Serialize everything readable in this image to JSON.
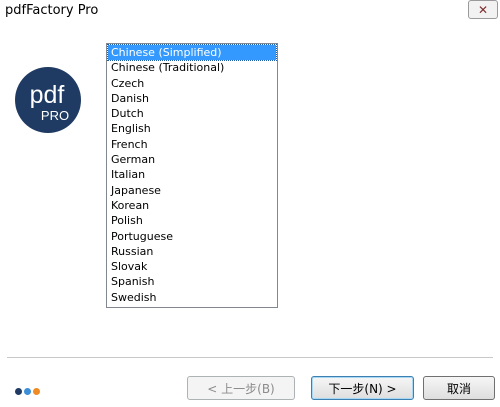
{
  "window": {
    "title": "pdfFactory Pro",
    "close_glyph": "✕"
  },
  "logo": {
    "line1": "pdf",
    "line2": "PRO",
    "color": "#1f3b63"
  },
  "language_list": {
    "selected_index": 0,
    "items": [
      "Chinese (Simplified)",
      "Chinese (Traditional)",
      "Czech",
      "Danish",
      "Dutch",
      "English",
      "French",
      "German",
      "Italian",
      "Japanese",
      "Korean",
      "Polish",
      "Portuguese",
      "Russian",
      "Slovak",
      "Spanish",
      "Swedish"
    ]
  },
  "progress_dots": {
    "colors": [
      "#1f3b63",
      "#3a8fd6",
      "#f08a24"
    ]
  },
  "buttons": {
    "back_label": "< 上一步(B)",
    "next_label": "下一步(N) >",
    "cancel_label": "取消"
  }
}
